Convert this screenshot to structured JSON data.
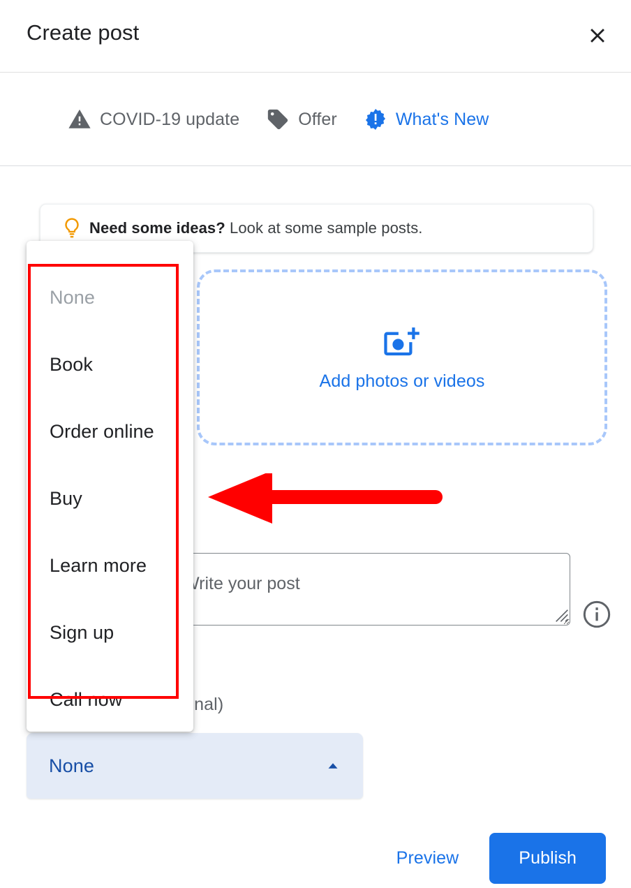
{
  "dialog": {
    "title": "Create post",
    "close_icon": "close-icon"
  },
  "tabs": {
    "items": [
      {
        "label": "COVID-19 update",
        "icon": "warning-triangle-icon",
        "active": false
      },
      {
        "label": "Offer",
        "icon": "tag-icon",
        "active": false
      },
      {
        "label": "What's New",
        "icon": "badge-exclamation-icon",
        "active": true
      }
    ],
    "next_icon": "chevron-right-icon"
  },
  "ideas_banner": {
    "icon": "lightbulb-icon",
    "bold_text": "Need some ideas?",
    "text": " Look at some sample posts."
  },
  "photo_dropzone": {
    "icon": "add-a-photo-icon",
    "label": "Add photos or videos"
  },
  "post_text": {
    "placeholder": "Write your post",
    "value": "",
    "info_icon": "info-circle-icon",
    "resize_handle": "resize-grip-icon"
  },
  "button_section": {
    "label": "Add a button (optional)",
    "selected_value": "None",
    "caret_icon": "caret-up-icon"
  },
  "dropdown": {
    "items": [
      {
        "label": "None",
        "disabled": true
      },
      {
        "label": "Book",
        "disabled": false
      },
      {
        "label": "Order online",
        "disabled": false
      },
      {
        "label": "Buy",
        "disabled": false
      },
      {
        "label": "Learn more",
        "disabled": false
      },
      {
        "label": "Sign up",
        "disabled": false
      },
      {
        "label": "Call now",
        "disabled": false
      }
    ]
  },
  "annotations": {
    "highlight_color": "#ff0000",
    "arrow_color": "#ff0000",
    "arrow_direction": "left"
  },
  "footer": {
    "preview_label": "Preview",
    "publish_label": "Publish"
  },
  "colors": {
    "accent_blue": "#1a73e8",
    "tab_inactive": "#5f6368",
    "select_bg": "#e4ebf7",
    "select_text": "#174ea6",
    "dropzone_border": "#a8c7fa",
    "bulb_orange": "#f29900"
  }
}
